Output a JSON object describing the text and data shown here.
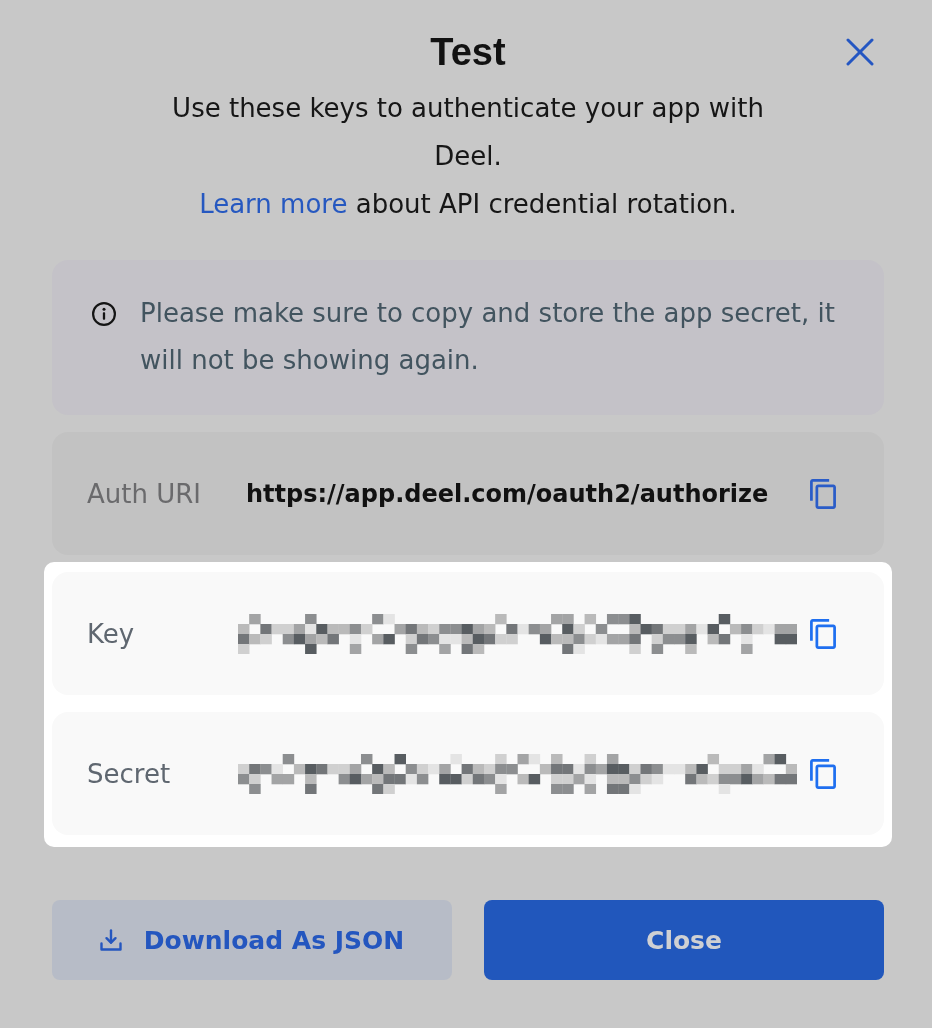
{
  "dialog": {
    "title": "Test",
    "description": "Use these keys to authenticate your app with Deel.",
    "rotation_note": {
      "link": "Learn more",
      "text": "about API credential rotation."
    }
  },
  "notice": {
    "message": "Please make sure to copy and store the app secret, it will not be showing again."
  },
  "fields": [
    {
      "label": "Auth URI",
      "kind": "text",
      "value": "https://app.deel.com/oauth2/authorize",
      "highlighted": false
    },
    {
      "label": "Key",
      "kind": "masked",
      "highlighted": true
    },
    {
      "label": "Secret",
      "kind": "masked",
      "highlighted": true
    }
  ],
  "buttons": [
    {
      "label": "Download As JSON",
      "kind": "secondary"
    },
    {
      "label": "Close",
      "kind": "primary"
    }
  ]
}
